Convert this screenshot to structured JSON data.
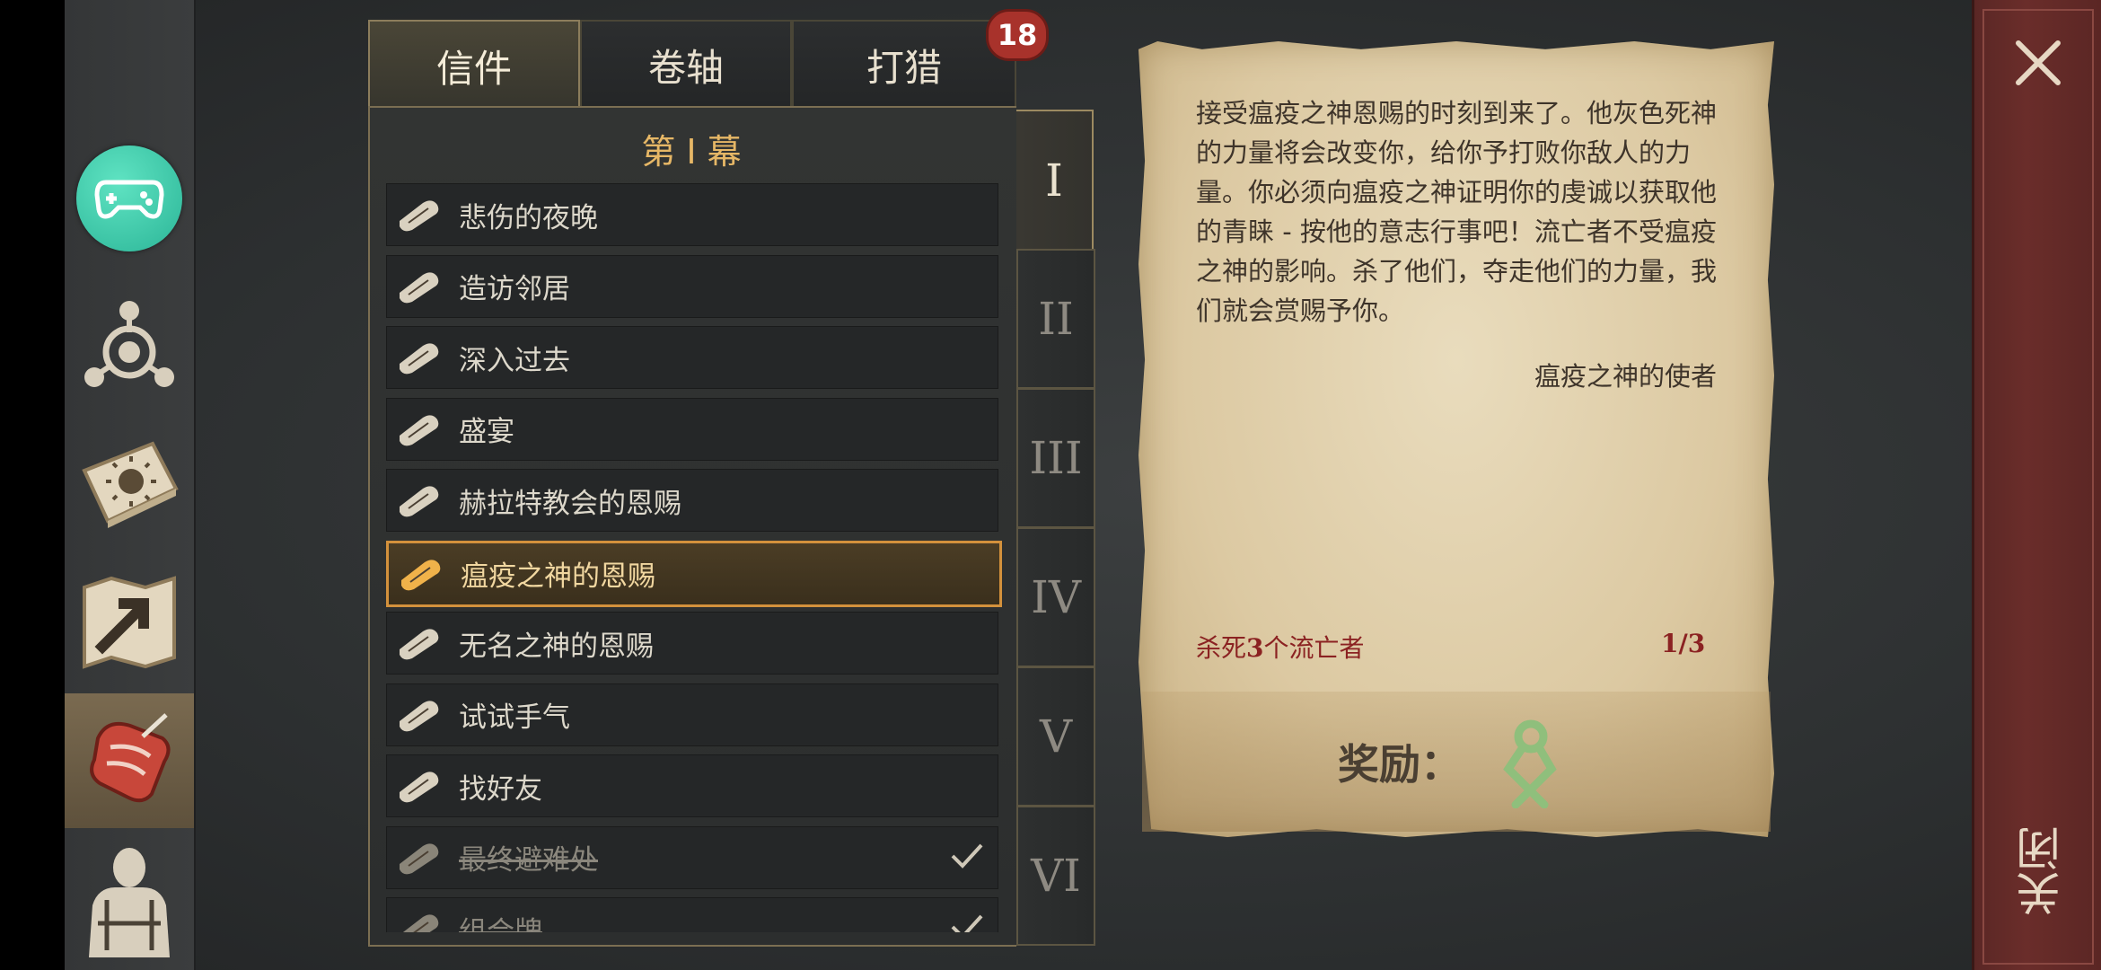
{
  "tabs": [
    {
      "label": "信件",
      "active": true
    },
    {
      "label": "卷轴",
      "active": false
    },
    {
      "label": "打猎",
      "active": false
    }
  ],
  "hunt_badge": "18",
  "act_title": "第 I 幕",
  "quests": [
    {
      "label": "悲伤的夜晚",
      "state": "normal"
    },
    {
      "label": "造访邻居",
      "state": "normal"
    },
    {
      "label": "深入过去",
      "state": "normal"
    },
    {
      "label": "盛宴",
      "state": "normal"
    },
    {
      "label": "赫拉特教会的恩赐",
      "state": "normal"
    },
    {
      "label": "瘟疫之神的恩赐",
      "state": "selected"
    },
    {
      "label": "无名之神的恩赐",
      "state": "normal"
    },
    {
      "label": "试试手气",
      "state": "normal"
    },
    {
      "label": "找好友",
      "state": "normal"
    },
    {
      "label": "最终避难处",
      "state": "done"
    },
    {
      "label": "组合牌",
      "state": "done"
    }
  ],
  "acts": [
    "I",
    "II",
    "III",
    "IV",
    "V",
    "VI"
  ],
  "letter": {
    "text": "接受瘟疫之神恩赐的时刻到来了。他灰色死神的力量将会改变你，给你予打败你敌人的力量。你必须向瘟疫之神证明你的虔诚以获取他的青睐 - 按他的意志行事吧！流亡者不受瘟疫之神的影响。杀了他们，夺走他们的力量，我们就会赏赐予你。",
    "signature": "瘟疫之神的使者",
    "objective_prefix": "杀死",
    "objective_count": "3",
    "objective_suffix": "个流亡者",
    "progress": "1/3",
    "reward_label": "奖励："
  },
  "close_label": "关闭",
  "colors": {
    "accent": "#d3913c",
    "objective": "#8b2222",
    "teal": "#2bb597"
  }
}
